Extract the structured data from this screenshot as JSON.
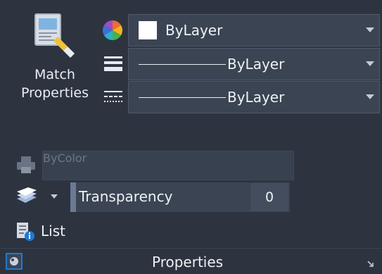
{
  "match": {
    "line1": "Match",
    "line2": "Properties"
  },
  "color": {
    "value": "ByLayer"
  },
  "lineweight": {
    "value": "ByLayer"
  },
  "linetype": {
    "value": "ByLayer"
  },
  "plotstyle": {
    "value": "ByColor",
    "enabled": false
  },
  "transparency": {
    "label": "Transparency",
    "value": "0"
  },
  "list": {
    "label": "List"
  },
  "footer": {
    "title": "Properties"
  },
  "colors": {
    "background": "#2d3440",
    "field": "#3b4453",
    "accent": "#1e7bd2"
  },
  "icons": [
    "match-properties-icon",
    "color-wheel-icon",
    "lineweight-icon",
    "linetype-icon",
    "plot-style-icon",
    "layers-icon",
    "list-icon",
    "panel-pin-icon",
    "dialog-launcher-icon"
  ]
}
